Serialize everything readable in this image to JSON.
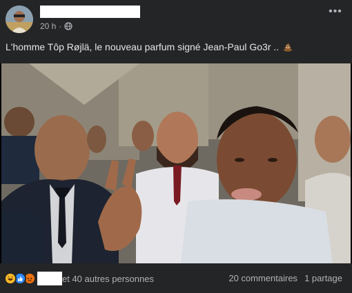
{
  "post": {
    "time": "20 h",
    "privacy_icon": "globe-icon",
    "more_icon": "more-horizontal-icon",
    "text": "L'homme Tôp Røjlä, le nouveau parfum signé Jean-Paul Go3r ..",
    "emoji": "pile-of-poo"
  },
  "footer": {
    "reactions": [
      "haha",
      "like",
      "angry"
    ],
    "reactions_text": "et 40 autres personnes",
    "comments": "20 commentaires",
    "shares": "1 partage"
  },
  "colors": {
    "background": "#242526",
    "text": "#e4e6eb",
    "muted": "#b0b3b8",
    "like": "#2d88ff",
    "haha": "#f7b928",
    "angry": "#e9710f"
  }
}
